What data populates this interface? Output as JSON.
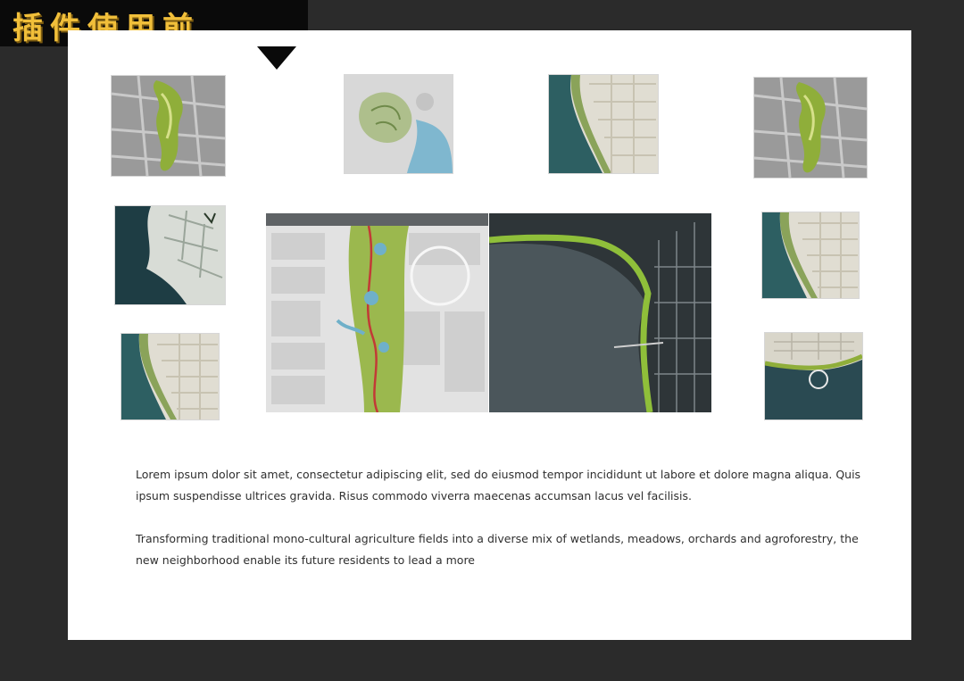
{
  "banner": {
    "title": "插件使用前"
  },
  "gallery": {
    "images": [
      {
        "name": "green-park-corridor-plan",
        "palette": "gray-green"
      },
      {
        "name": "hillside-district-plan",
        "palette": "light-blue"
      },
      {
        "name": "riverside-urban-plan",
        "palette": "beige-teal"
      },
      {
        "name": "green-park-corridor-plan-2",
        "palette": "gray-green"
      },
      {
        "name": "coastal-dark-map",
        "palette": "dark-teal"
      },
      {
        "name": "central-green-axis-masterplan",
        "palette": "gray-green-red"
      },
      {
        "name": "bay-waterfront-masterplan",
        "palette": "slate-green"
      },
      {
        "name": "riverside-urban-plan-2",
        "palette": "beige-teal"
      },
      {
        "name": "riverside-urban-plan-3",
        "palette": "beige-teal"
      },
      {
        "name": "waterfront-crescent-plan",
        "palette": "dark-teal"
      }
    ]
  },
  "text": {
    "paragraph_1": "Lorem ipsum dolor sit amet, consectetur adipiscing elit, sed do eiusmod tempor incididunt ut labore et dolore magna aliqua. Quis ipsum suspendisse ultrices gravida. Risus commodo viverra maecenas accumsan lacus vel facilisis.",
    "paragraph_2": "Transforming traditional mono-cultural agriculture fields into a diverse mix of wetlands, meadows, orchards and agroforestry, the new neighborhood enable its future residents to lead a more"
  }
}
